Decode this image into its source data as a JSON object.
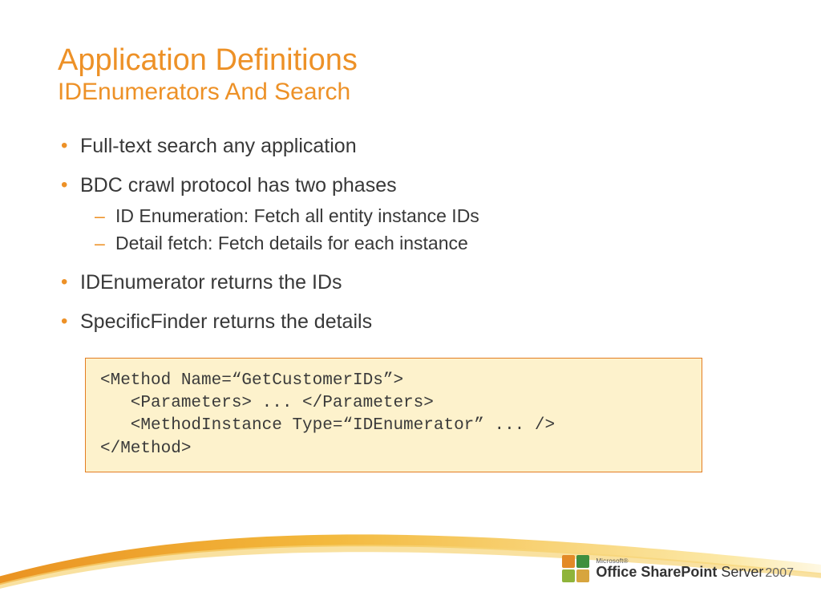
{
  "title": {
    "main": "Application Definitions",
    "sub": "IDEnumerators And Search"
  },
  "bullets": [
    {
      "text": "Full-text search any application",
      "sub": []
    },
    {
      "text": "BDC crawl protocol has two phases",
      "sub": [
        "ID Enumeration: Fetch all entity instance IDs",
        "Detail fetch: Fetch details for each instance"
      ]
    },
    {
      "text": "IDEnumerator returns the IDs",
      "sub": []
    },
    {
      "text": "SpecificFinder returns the details",
      "sub": []
    }
  ],
  "code": "<Method Name=“GetCustomerIDs”>\n   <Parameters> ... </Parameters>\n   <MethodInstance Type=“IDEnumerator” ... />\n</Method>",
  "badge": {
    "ms": "Microsoft®",
    "line1": "Office",
    "line2": "SharePoint",
    "line3": "Server",
    "year": "2007"
  }
}
